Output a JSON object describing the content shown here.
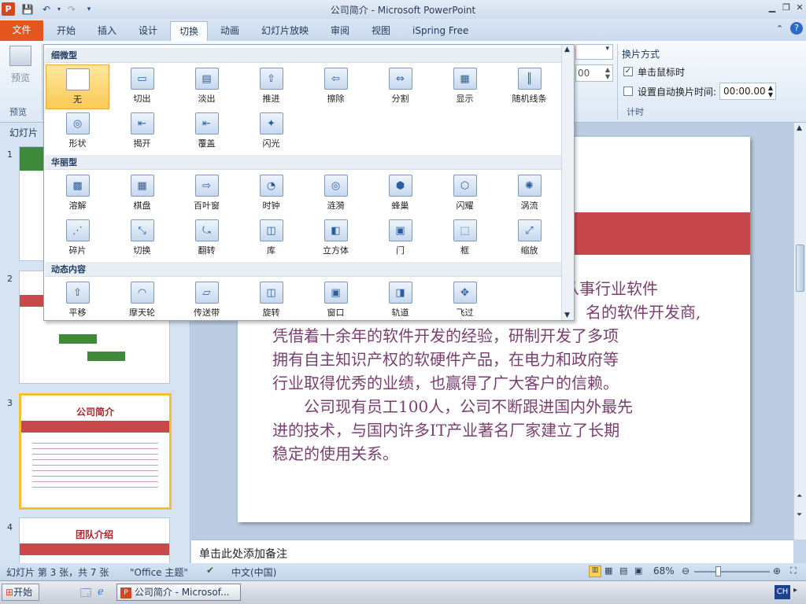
{
  "app": {
    "title": "公司简介 - Microsoft PowerPoint",
    "logo": "P"
  },
  "tabs": [
    "文件",
    "开始",
    "插入",
    "设计",
    "切换",
    "动画",
    "幻灯片放映",
    "审阅",
    "视图",
    "iSpring Free"
  ],
  "ribbon": {
    "preview_label": "预览",
    "preview_group": "预览",
    "advance_title": "换片方式",
    "on_click_label": "单击鼠标时",
    "auto_after_label": "设置自动换片时间:",
    "auto_after_value": "00:00.00",
    "duration_value": "00",
    "timing_group": "计时"
  },
  "gallery": {
    "sections": [
      {
        "title": "细微型",
        "items": [
          "无",
          "切出",
          "淡出",
          "推进",
          "擦除",
          "分割",
          "显示",
          "随机线条",
          "形状",
          "揭开",
          "覆盖",
          "闪光"
        ]
      },
      {
        "title": "华丽型",
        "items": [
          "溶解",
          "棋盘",
          "百叶窗",
          "时钟",
          "涟漪",
          "蜂巢",
          "闪耀",
          "涡流",
          "碎片",
          "切换",
          "翻转",
          "库",
          "立方体",
          "门",
          "框",
          "缩放"
        ]
      },
      {
        "title": "动态内容",
        "items": [
          "平移",
          "摩天轮",
          "传送带",
          "旋转",
          "窗口",
          "轨道",
          "飞过"
        ]
      }
    ]
  },
  "leftpane": {
    "tab_label": "幻灯片",
    "thumbs": [
      {
        "num": "1",
        "title": ""
      },
      {
        "num": "2",
        "title": ""
      },
      {
        "num": "3",
        "title": "公司简介"
      },
      {
        "num": "4",
        "title": "团队介绍"
      }
    ]
  },
  "slide": {
    "lines": [
      "从事行业软件",
      "名的软件开发商,",
      "凭借着十余年的软件开发的经验，研制开发了多项",
      "拥有自主知识产权的软硬件产品，在电力和政府等",
      "行业取得优秀的业绩，也赢得了广大客户的信赖。",
      "　　公司现有员工100人，公司不断跟进国内外最先",
      "进的技术，与国内许多IT产业著名厂家建立了长期",
      "稳定的使用关系。"
    ]
  },
  "notes_placeholder": "单击此处添加备注",
  "status": {
    "slide_info": "幻灯片 第 3 张，共 7 张",
    "theme": "\"Office 主题\"",
    "language": "中文(中国)",
    "zoom": "68%"
  },
  "taskbar": {
    "start": "开始",
    "window": "公司简介 - Microsof...",
    "ime": "CH"
  }
}
